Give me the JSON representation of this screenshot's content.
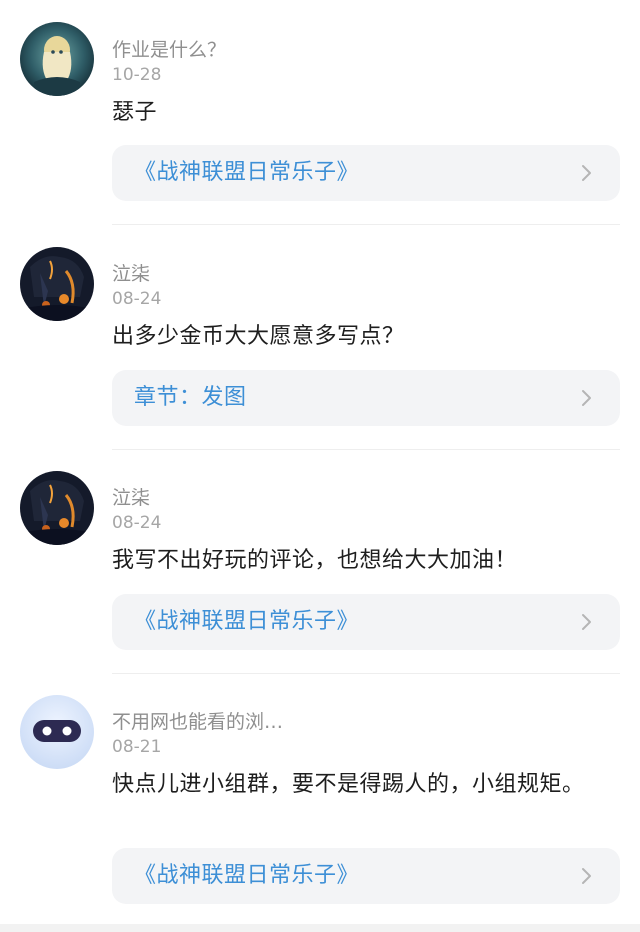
{
  "comments": [
    {
      "username": "作业是什么？",
      "date": "10-28",
      "text": "瑟子",
      "reference": "《战神联盟日常乐子》"
    },
    {
      "username": "泣柒",
      "date": "08-24",
      "text": "出多少金币大大愿意多写点？",
      "reference": "章节：发图"
    },
    {
      "username": "泣柒",
      "date": "08-24",
      "text": "我写不出好玩的评论，也想给大大加油！",
      "reference": "《战神联盟日常乐子》"
    },
    {
      "username": "不用网也能看的浏…",
      "date": "08-21",
      "text": "快点儿进小组群，要不是得踢人的，小组规矩。",
      "reference": "《战神联盟日常乐子》"
    }
  ],
  "colors": {
    "link": "#3d8fd6",
    "card_bg": "#f3f4f6",
    "muted": "#8f8f8f"
  },
  "icons": {
    "chevron": "chevron-right-icon"
  }
}
